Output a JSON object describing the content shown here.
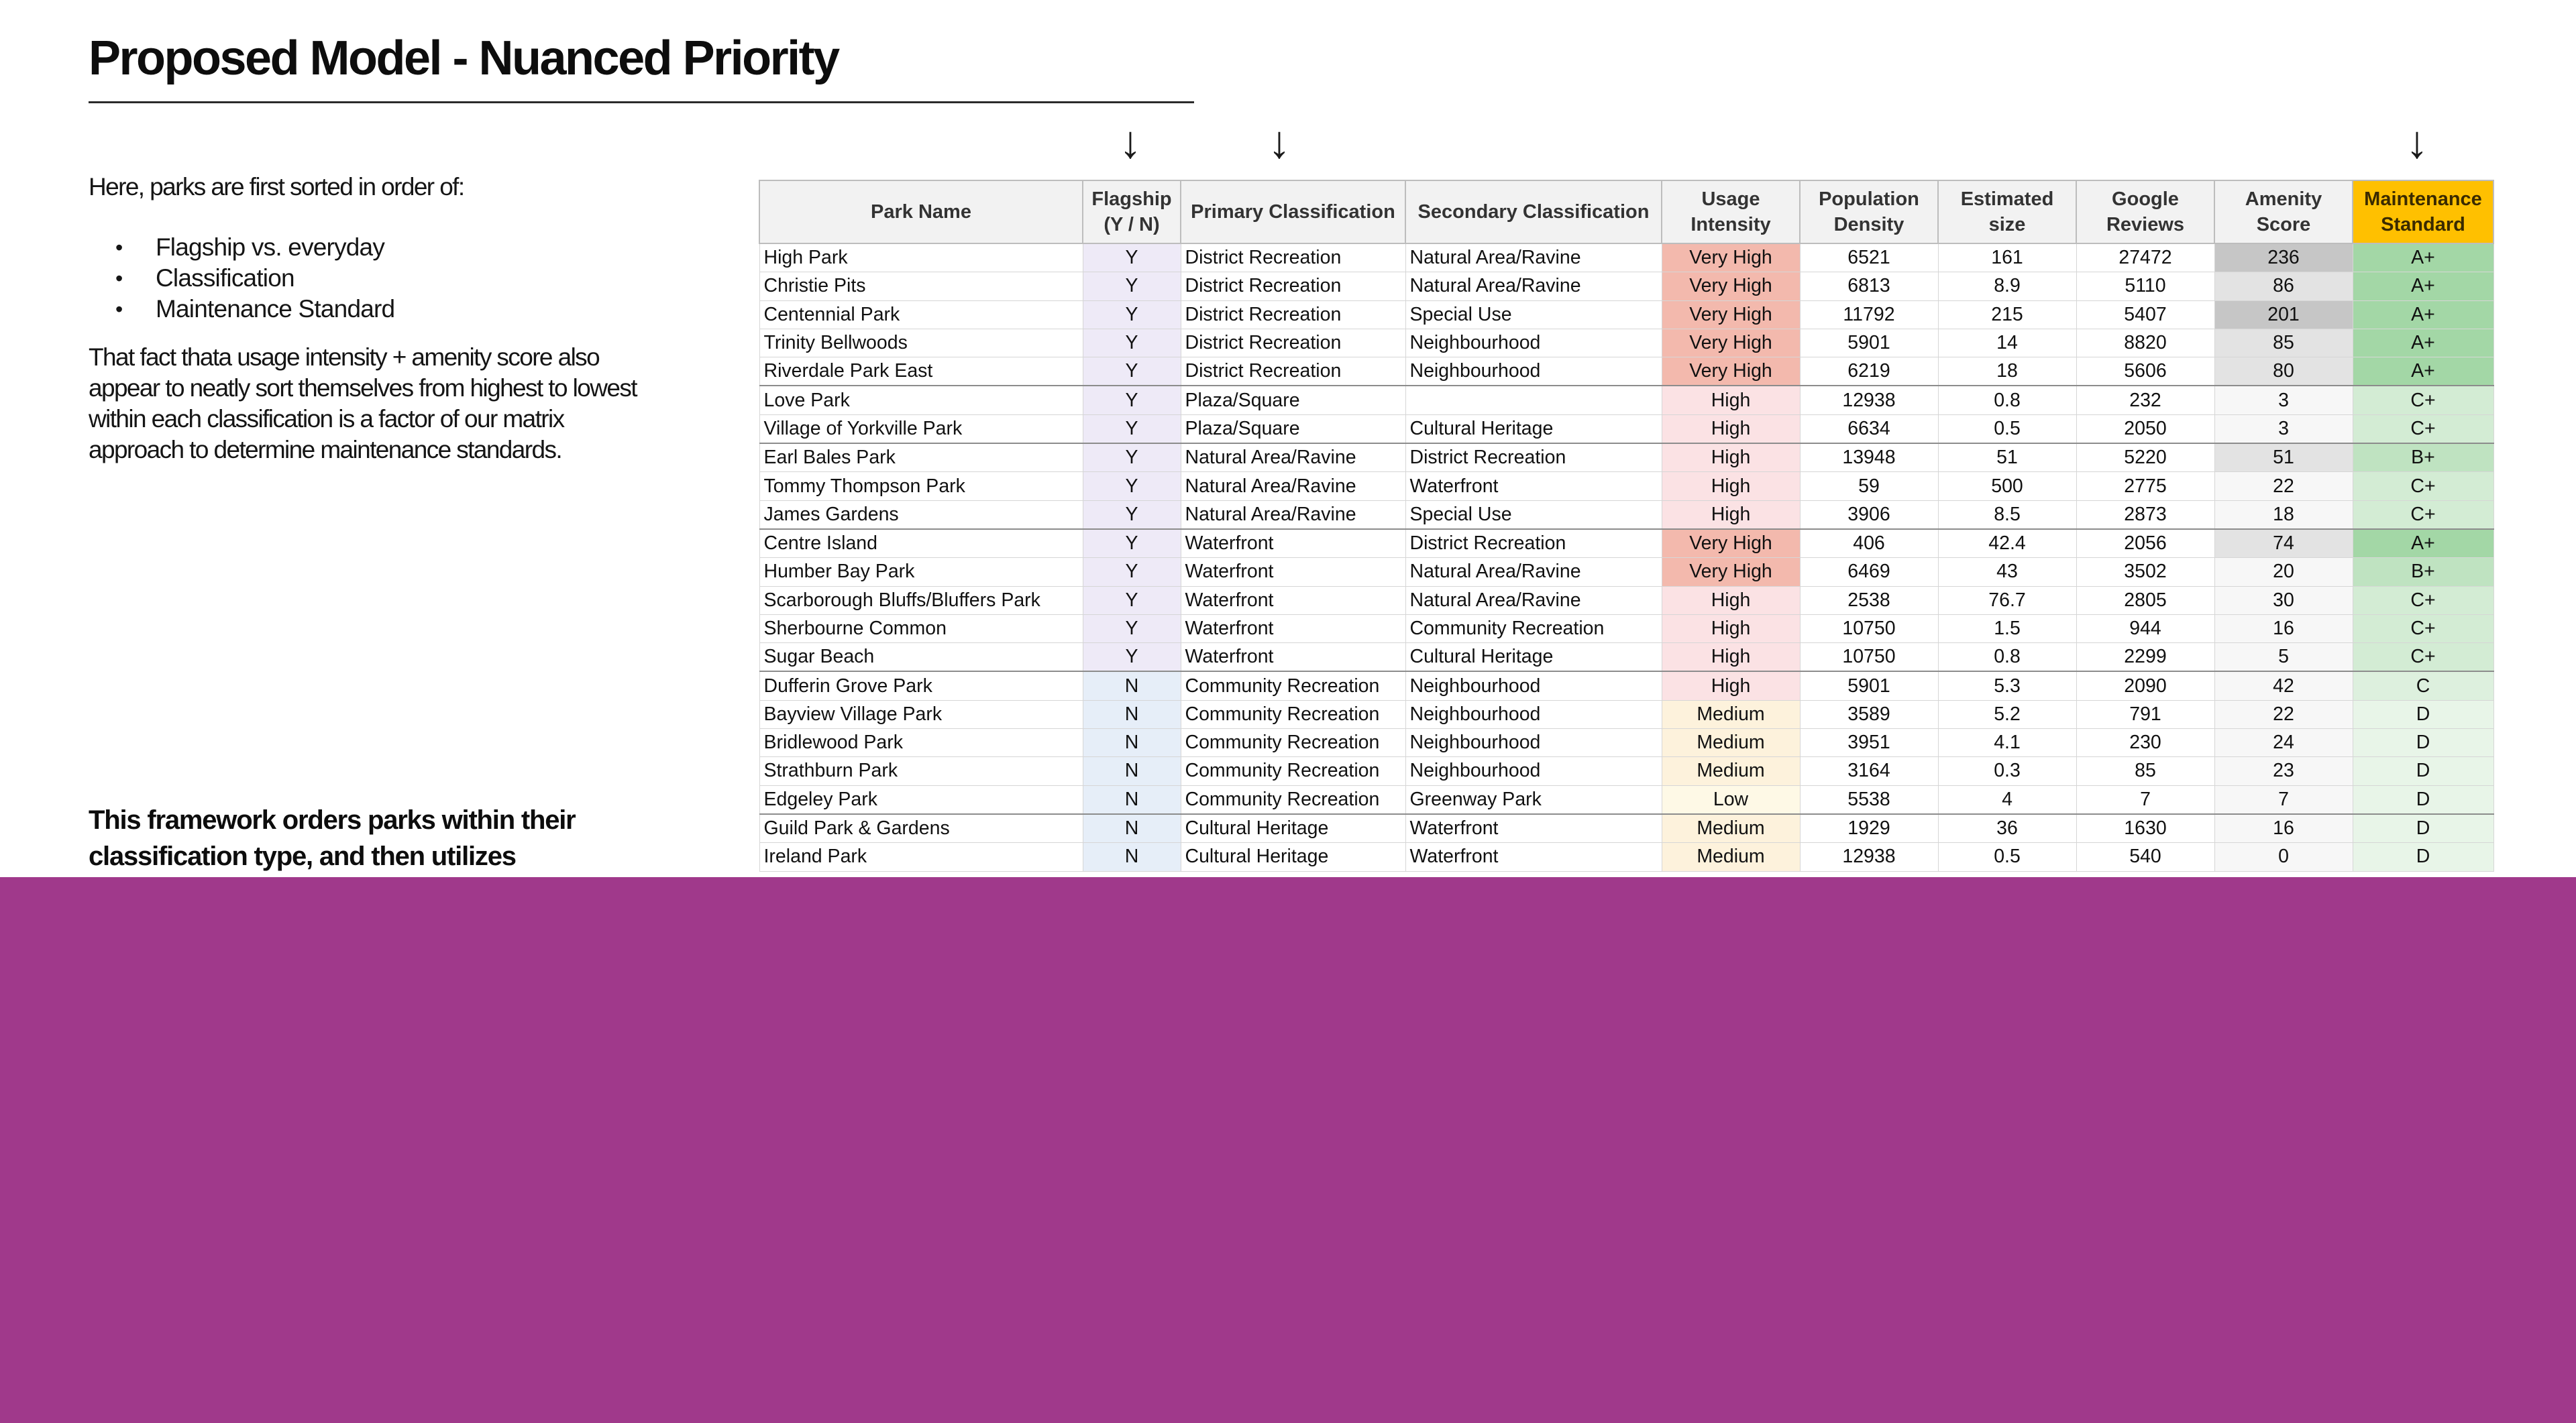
{
  "title": "Proposed Model - Nuanced Priority",
  "intro": "Here, parks are first sorted in order of:",
  "bullets": [
    "Flagship vs. everyday",
    "Classification",
    "Maintenance Standard"
  ],
  "body_paragraph": "That fact thata usage intensity + amenity score also appear to neatly sort themselves from highest to lowest within each classification is a factor of our matrix approach to determine maintenance standards.",
  "framework_note": "This framework orders parks within their classification type, and then utilizes",
  "arrows": {
    "flagship": "↓",
    "primary": "↓",
    "maintenance": "↓"
  },
  "colors": {
    "maintenance_header": "#ffc000",
    "band": "#a0398b",
    "flagship_y_bg": "#eeeaf7",
    "flagship_n_bg": "#e6eef8",
    "usage": {
      "Very High": "#f3b9ad",
      "High": "#fbe2e4",
      "Medium": "#fdf2dc",
      "Low": "#fef9e6"
    },
    "maintenance": {
      "A+": "#a3d7a6",
      "B+": "#bfe3c1",
      "C+": "#d3ecd4",
      "C": "#ddf0de",
      "D": "#e8f5e8"
    },
    "amenity_high": "#c6c6c6",
    "amenity_mid": "#e3e3e3",
    "amenity_low": "#f7f7f7"
  },
  "table": {
    "columns": [
      "Park Name",
      "Flagship\n(Y / N)",
      "Primary Classification",
      "Secondary Classification",
      "Usage\nIntensity",
      "Population\nDensity",
      "Estimated\nsize",
      "Google\nReviews",
      "Amenity\nScore",
      "Maintenance\nStandard"
    ],
    "rows": [
      [
        "High Park",
        "Y",
        "District Recreation",
        "Natural Area/Ravine",
        "Very High",
        "6521",
        "161",
        "27472",
        "236",
        "A+"
      ],
      [
        "Christie Pits",
        "Y",
        "District Recreation",
        "Natural Area/Ravine",
        "Very High",
        "6813",
        "8.9",
        "5110",
        "86",
        "A+"
      ],
      [
        "Centennial Park",
        "Y",
        "District Recreation",
        "Special Use",
        "Very High",
        "11792",
        "215",
        "5407",
        "201",
        "A+"
      ],
      [
        "Trinity Bellwoods",
        "Y",
        "District Recreation",
        "Neighbourhood",
        "Very High",
        "5901",
        "14",
        "8820",
        "85",
        "A+"
      ],
      [
        "Riverdale Park East",
        "Y",
        "District Recreation",
        "Neighbourhood",
        "Very High",
        "6219",
        "18",
        "5606",
        "80",
        "A+"
      ],
      [
        "Love Park",
        "Y",
        "Plaza/Square",
        "",
        "High",
        "12938",
        "0.8",
        "232",
        "3",
        "C+"
      ],
      [
        "Village of Yorkville Park",
        "Y",
        "Plaza/Square",
        "Cultural Heritage",
        "High",
        "6634",
        "0.5",
        "2050",
        "3",
        "C+"
      ],
      [
        "Earl Bales Park",
        "Y",
        "Natural Area/Ravine",
        "District Recreation",
        "High",
        "13948",
        "51",
        "5220",
        "51",
        "B+"
      ],
      [
        "Tommy Thompson Park",
        "Y",
        "Natural Area/Ravine",
        "Waterfront",
        "High",
        "59",
        "500",
        "2775",
        "22",
        "C+"
      ],
      [
        "James Gardens",
        "Y",
        "Natural Area/Ravine",
        "Special Use",
        "High",
        "3906",
        "8.5",
        "2873",
        "18",
        "C+"
      ],
      [
        "Centre Island",
        "Y",
        "Waterfront",
        "District Recreation",
        "Very High",
        "406",
        "42.4",
        "2056",
        "74",
        "A+"
      ],
      [
        "Humber Bay Park",
        "Y",
        "Waterfront",
        "Natural Area/Ravine",
        "Very High",
        "6469",
        "43",
        "3502",
        "20",
        "B+"
      ],
      [
        "Scarborough Bluffs/Bluffers Park",
        "Y",
        "Waterfront",
        "Natural Area/Ravine",
        "High",
        "2538",
        "76.7",
        "2805",
        "30",
        "C+"
      ],
      [
        "Sherbourne Common",
        "Y",
        "Waterfront",
        "Community Recreation",
        "High",
        "10750",
        "1.5",
        "944",
        "16",
        "C+"
      ],
      [
        "Sugar Beach",
        "Y",
        "Waterfront",
        "Cultural Heritage",
        "High",
        "10750",
        "0.8",
        "2299",
        "5",
        "C+"
      ],
      [
        "Dufferin Grove Park",
        "N",
        "Community Recreation",
        "Neighbourhood",
        "High",
        "5901",
        "5.3",
        "2090",
        "42",
        "C"
      ],
      [
        "Bayview Village Park",
        "N",
        "Community Recreation",
        "Neighbourhood",
        "Medium",
        "3589",
        "5.2",
        "791",
        "22",
        "D"
      ],
      [
        "Bridlewood Park",
        "N",
        "Community Recreation",
        "Neighbourhood",
        "Medium",
        "3951",
        "4.1",
        "230",
        "24",
        "D"
      ],
      [
        "Strathburn Park",
        "N",
        "Community Recreation",
        "Neighbourhood",
        "Medium",
        "3164",
        "0.3",
        "85",
        "23",
        "D"
      ],
      [
        "Edgeley Park",
        "N",
        "Community Recreation",
        "Greenway Park",
        "Low",
        "5538",
        "4",
        "7",
        "7",
        "D"
      ],
      [
        "Guild Park & Gardens",
        "N",
        "Cultural Heritage",
        "Waterfront",
        "Medium",
        "1929",
        "36",
        "1630",
        "16",
        "D"
      ],
      [
        "Ireland Park",
        "N",
        "Cultural Heritage",
        "Waterfront",
        "Medium",
        "12938",
        "0.5",
        "540",
        "0",
        "D"
      ]
    ]
  }
}
